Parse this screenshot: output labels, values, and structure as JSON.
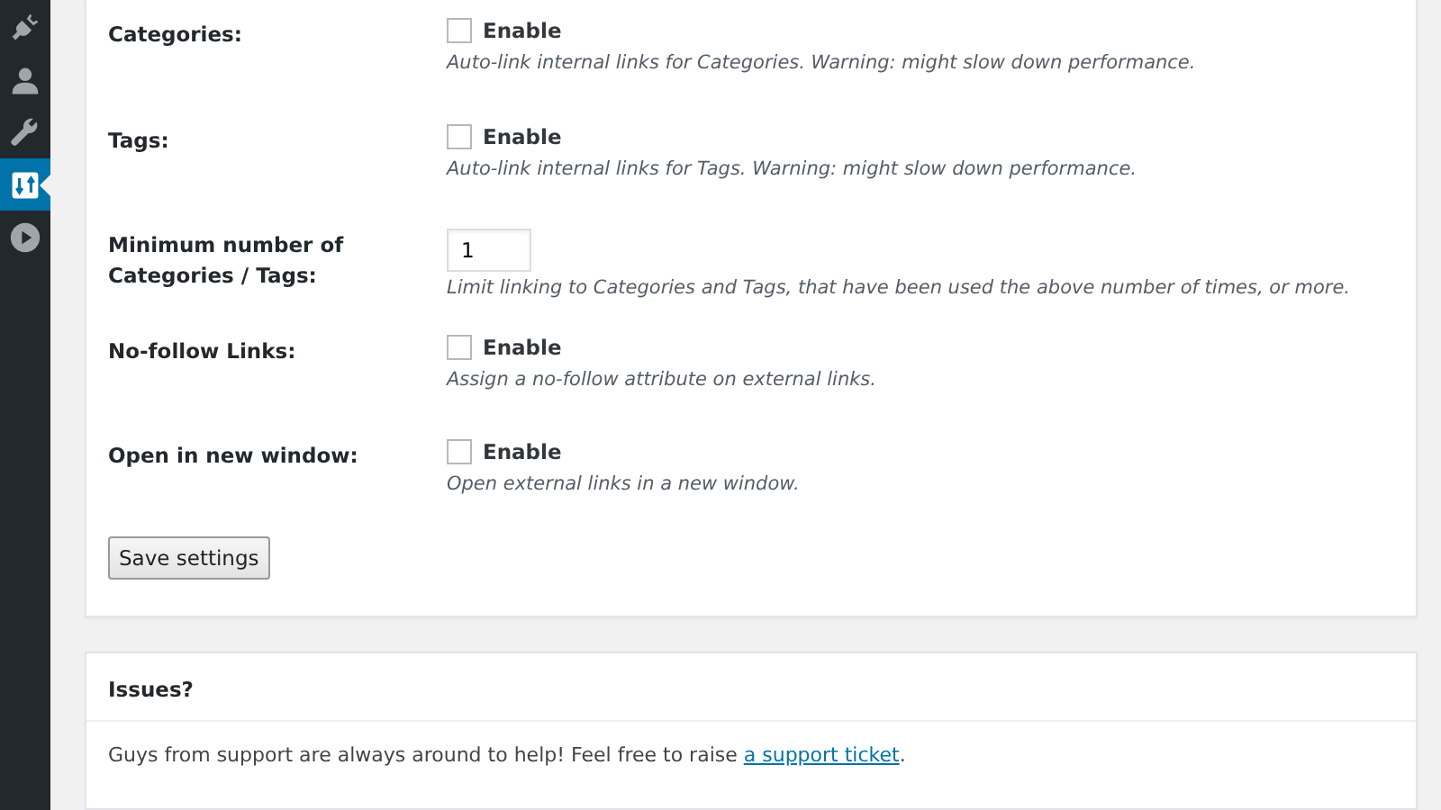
{
  "sidebar": {
    "items": [
      {
        "kind": "plug",
        "selected": false
      },
      {
        "kind": "user",
        "selected": false
      },
      {
        "kind": "wrench",
        "selected": false
      },
      {
        "kind": "settings",
        "selected": true
      },
      {
        "kind": "play",
        "selected": false
      }
    ]
  },
  "settings": [
    {
      "kind": "checkbox",
      "label": "Categories:",
      "option": "Enable",
      "checked": false,
      "description": "Auto-link internal links for Categories. Warning: might slow down performance."
    },
    {
      "kind": "checkbox",
      "label": "Tags:",
      "option": "Enable",
      "checked": false,
      "description": "Auto-link internal links for Tags. Warning: might slow down performance."
    },
    {
      "kind": "number",
      "label": "Minimum number of Categories / Tags:",
      "value": "1",
      "description": "Limit linking to Categories and Tags, that have been used the above number of times, or more."
    },
    {
      "kind": "checkbox",
      "label": "No-follow Links:",
      "option": "Enable",
      "checked": false,
      "description": "Assign a no-follow attribute on external links."
    },
    {
      "kind": "checkbox",
      "label": "Open in new window:",
      "option": "Enable",
      "checked": false,
      "description": "Open external links in a new window."
    }
  ],
  "save_button": "Save settings",
  "issues": {
    "title": "Issues?",
    "text": "Guys from support are always around to help! Feel free to raise ",
    "link": "a support ticket",
    "after": "."
  }
}
